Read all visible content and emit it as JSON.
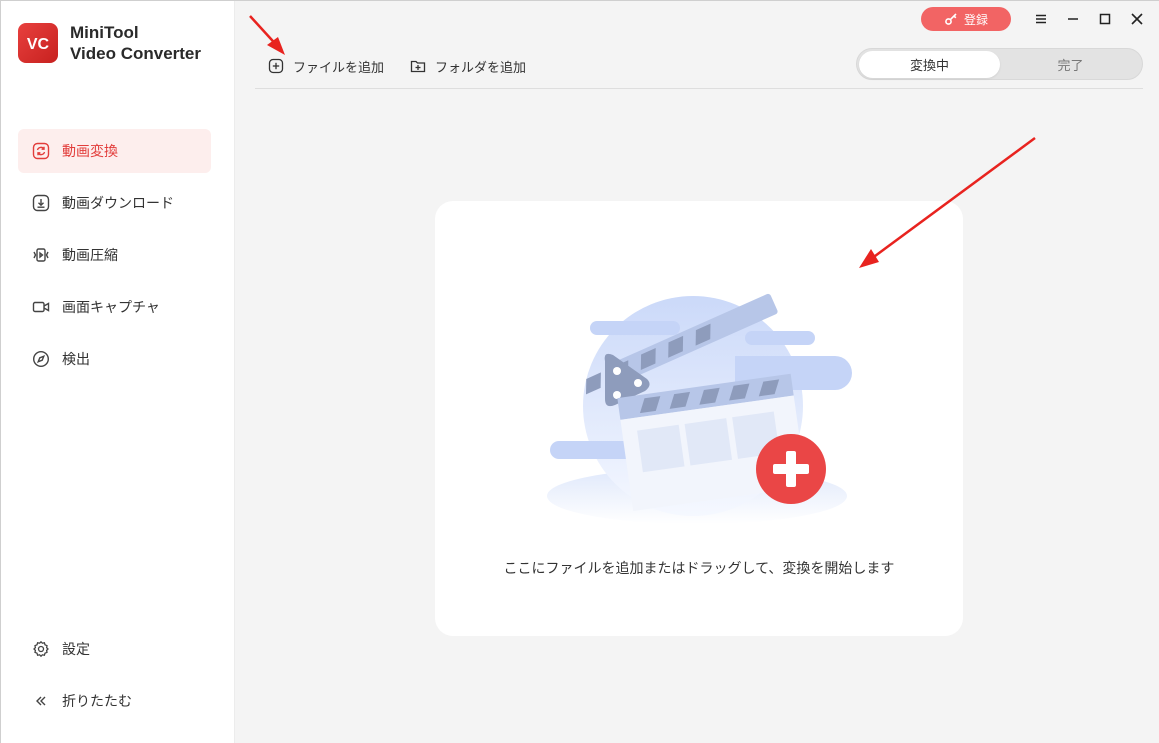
{
  "app": {
    "name_line1": "MiniTool",
    "name_line2": "Video Converter",
    "logo_text": "VC"
  },
  "sidebar": {
    "items": [
      {
        "label": "動画変換",
        "icon": "convert-icon",
        "active": true
      },
      {
        "label": "動画ダウンロード",
        "icon": "download-icon",
        "active": false
      },
      {
        "label": "動画圧縮",
        "icon": "compress-icon",
        "active": false
      },
      {
        "label": "画面キャプチャ",
        "icon": "camera-icon",
        "active": false
      },
      {
        "label": "検出",
        "icon": "compass-icon",
        "active": false
      }
    ],
    "bottom": [
      {
        "label": "設定",
        "icon": "gear-icon"
      },
      {
        "label": "折りたたむ",
        "icon": "collapse-icon"
      }
    ]
  },
  "toolbar": {
    "add_file": "ファイルを追加",
    "add_folder": "フォルダを追加"
  },
  "tabs": {
    "converting": "変換中",
    "done": "完了"
  },
  "window": {
    "register": "登録"
  },
  "dropzone": {
    "text": "ここにファイルを追加またはドラッグして、変換を開始します"
  },
  "colors": {
    "accent": "#e23d3b",
    "register_bg": "#f26464",
    "annotation_arrow": "#e8231f"
  }
}
